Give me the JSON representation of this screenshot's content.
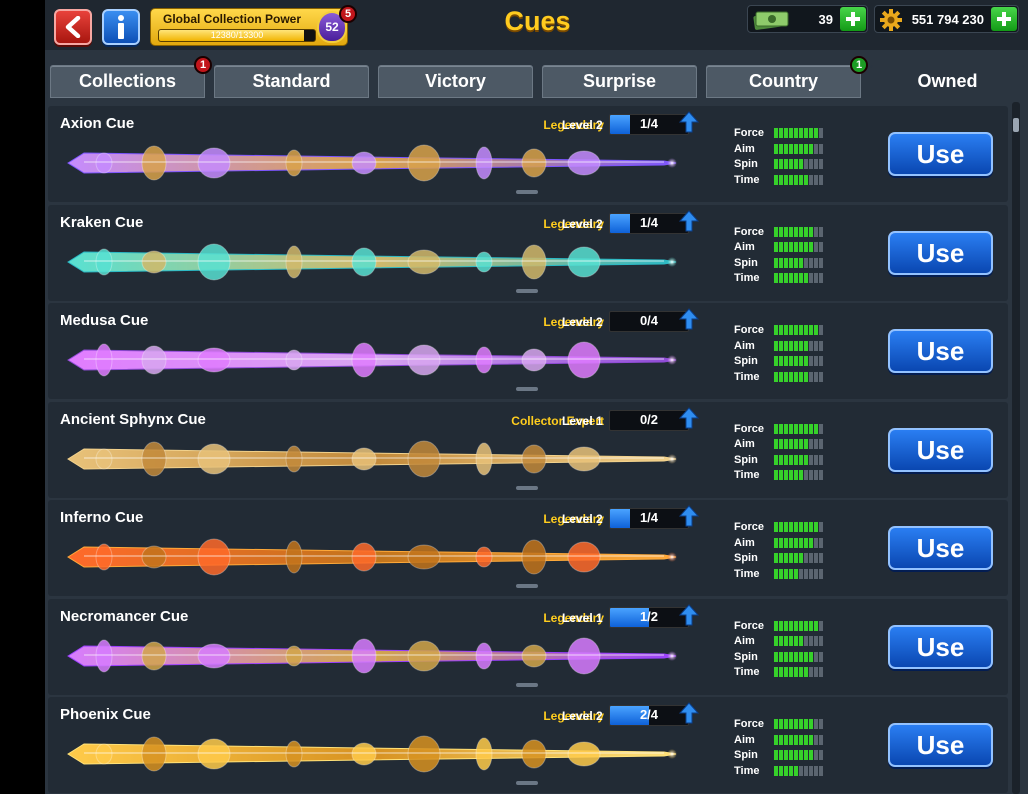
{
  "header": {
    "title": "Cues",
    "global_collection_power": {
      "label": "Global Collection Power",
      "progress_text": "12380/13300",
      "progress_fraction": 0.931,
      "level": "52",
      "badge": "5"
    },
    "cash": {
      "value": "39",
      "icon": "cash-icon"
    },
    "coins": {
      "value": "551 794 230",
      "icon": "coin-gear-icon"
    }
  },
  "tabs": [
    {
      "label": "Collections",
      "badge": "1"
    },
    {
      "label": "Standard",
      "badge": ""
    },
    {
      "label": "Victory",
      "badge": ""
    },
    {
      "label": "Surprise",
      "badge": ""
    },
    {
      "label": "Country",
      "badge": "1"
    },
    {
      "label": "Owned",
      "badge": "",
      "active": true
    }
  ],
  "stat_labels": [
    "Force",
    "Aim",
    "Spin",
    "Time"
  ],
  "use_label": "Use",
  "cues": [
    {
      "name": "Axion Cue",
      "rarity": "Legendary",
      "level": "Level 2",
      "progress": "1/4",
      "fill": 0.25,
      "stats": [
        9,
        8,
        6,
        7
      ],
      "colors": [
        "#c58bff",
        "#d9a24a",
        "#7d56ff"
      ]
    },
    {
      "name": "Kraken Cue",
      "rarity": "Legendary",
      "level": "Level 2",
      "progress": "1/4",
      "fill": 0.25,
      "stats": [
        8,
        8,
        6,
        7
      ],
      "colors": [
        "#58e1d2",
        "#d2b96a",
        "#2bb9c5"
      ]
    },
    {
      "name": "Medusa Cue",
      "rarity": "Legendary",
      "level": "Level 2",
      "progress": "0/4",
      "fill": 0,
      "stats": [
        9,
        7,
        7,
        7
      ],
      "colors": [
        "#e07cff",
        "#d8a6f0",
        "#8f4bd6"
      ]
    },
    {
      "name": "Ancient Sphynx Cue",
      "rarity": "Collector Expert",
      "level": "Level 1",
      "progress": "0/2",
      "fill": 0,
      "stats": [
        9,
        7,
        7,
        6
      ],
      "colors": [
        "#e8c27a",
        "#c2893a",
        "#f2d28d"
      ]
    },
    {
      "name": "Inferno Cue",
      "rarity": "Legendary",
      "level": "Level 2",
      "progress": "1/4",
      "fill": 0.25,
      "stats": [
        9,
        8,
        6,
        5
      ],
      "colors": [
        "#ff6a2a",
        "#c2741c",
        "#ffaa3a"
      ]
    },
    {
      "name": "Necromancer Cue",
      "rarity": "Legendary",
      "level": "Level 1",
      "progress": "1/2",
      "fill": 0.5,
      "stats": [
        9,
        6,
        8,
        7
      ],
      "colors": [
        "#d77cff",
        "#d2a64a",
        "#9b40ff"
      ]
    },
    {
      "name": "Phoenix Cue",
      "rarity": "Legendary",
      "level": "Level 2",
      "progress": "2/4",
      "fill": 0.5,
      "stats": [
        8,
        8,
        8,
        5
      ],
      "colors": [
        "#ffcb4a",
        "#d79221",
        "#ffe27a"
      ]
    }
  ]
}
